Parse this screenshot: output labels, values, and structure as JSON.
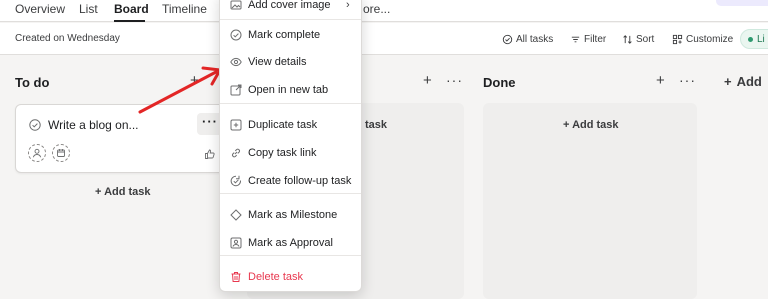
{
  "nav": {
    "tabs": [
      "Overview",
      "List",
      "Board",
      "Timeline"
    ],
    "truncated_tab": "ore..."
  },
  "subheader": {
    "created": "Created on Wednesday",
    "all_tasks": "All tasks",
    "filter": "Filter",
    "sort": "Sort",
    "customize": "Customize",
    "chip": "Li"
  },
  "board": {
    "columns": [
      {
        "title": "To do",
        "add_task": "+ Add task"
      },
      {
        "title": "",
        "add_task": "task"
      },
      {
        "title": "Done",
        "add_task": "+ Add task"
      }
    ],
    "add_section": "Add",
    "card": {
      "title": "Write a blog on..."
    }
  },
  "menu": {
    "items": [
      {
        "label": "Add cover image",
        "icon": "image-icon"
      },
      {
        "label": "Mark complete",
        "icon": "check-circle-icon"
      },
      {
        "label": "View details",
        "icon": "eye-icon"
      },
      {
        "label": "Open in new tab",
        "icon": "external-link-icon"
      },
      {
        "label": "Duplicate task",
        "icon": "duplicate-icon"
      },
      {
        "label": "Copy task link",
        "icon": "link-icon"
      },
      {
        "label": "Create follow-up task",
        "icon": "follow-up-icon"
      },
      {
        "label": "Mark as Milestone",
        "icon": "diamond-icon"
      },
      {
        "label": "Mark as Approval",
        "icon": "approval-icon"
      },
      {
        "label": "Delete task",
        "icon": "trash-icon"
      }
    ]
  },
  "colors": {
    "accent_red": "#e8384f",
    "arrow_red": "#e32626",
    "chip_green": "#2e9a6f",
    "page_bg": "#f5f4f3"
  }
}
